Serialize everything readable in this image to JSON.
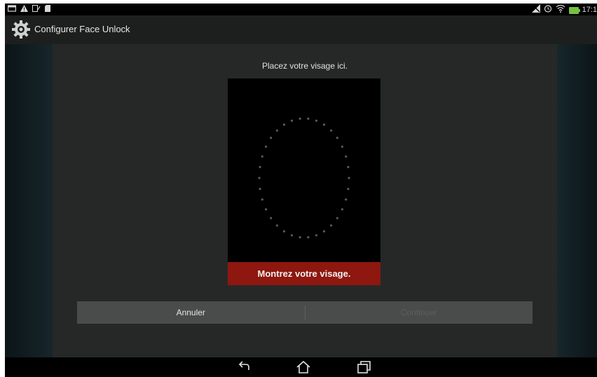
{
  "status_bar": {
    "time": "17:1",
    "left_icons": [
      "screen-icon",
      "warning-icon",
      "nfc-icon",
      "sd-card-icon"
    ],
    "right_icons": [
      "no-signal-icon",
      "alarm-icon",
      "wifi-icon",
      "battery-charging-icon"
    ]
  },
  "action_bar": {
    "title": "Configurer Face Unlock",
    "icon": "settings-gear-icon"
  },
  "dialog": {
    "instruction": "Placez votre visage ici.",
    "message": "Montrez votre visage.",
    "message_color": "#8e170f",
    "buttons": {
      "cancel_label": "Annuler",
      "continue_label": "Continuer"
    }
  },
  "nav_bar": {
    "icons": [
      "back-icon",
      "home-icon",
      "recent-apps-icon"
    ]
  }
}
